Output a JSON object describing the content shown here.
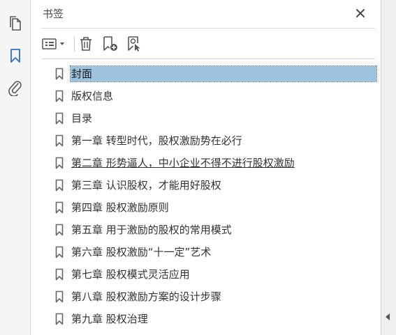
{
  "left_rail": {
    "items": [
      {
        "name": "pages-thumbnails-icon",
        "active": false
      },
      {
        "name": "bookmark-icon",
        "active": true
      },
      {
        "name": "attachment-icon",
        "active": false
      }
    ]
  },
  "panel": {
    "title": "书签",
    "close_icon": "close-icon"
  },
  "toolbar": {
    "items": [
      "options-menu-icon",
      "delete-bookmark-icon",
      "new-bookmark-icon",
      "new-bookmark-from-structure-icon"
    ]
  },
  "bookmarks": [
    {
      "label": "封面",
      "selected": true
    },
    {
      "label": "版权信息"
    },
    {
      "label": "目录"
    },
    {
      "label": "第一章 转型时代，股权激励势在必行"
    },
    {
      "label": "第二章 形势逼人，中小企业不得不进行股权激励",
      "hover": true
    },
    {
      "label": "第三章 认识股权，才能用好股权"
    },
    {
      "label": "第四章 股权激励原则"
    },
    {
      "label": "第五章 用于激励的股权的常用模式"
    },
    {
      "label": "第六章 股权激励“十一定”艺术"
    },
    {
      "label": "第七章 股权模式灵活应用"
    },
    {
      "label": "第八章 股权激励方案的设计步骤"
    },
    {
      "label": "第九章 股权治理"
    }
  ],
  "colors": {
    "accent_blue": "#2b6fd1",
    "selection": "#9ec3de",
    "icon_gray": "#5a5a5a"
  }
}
